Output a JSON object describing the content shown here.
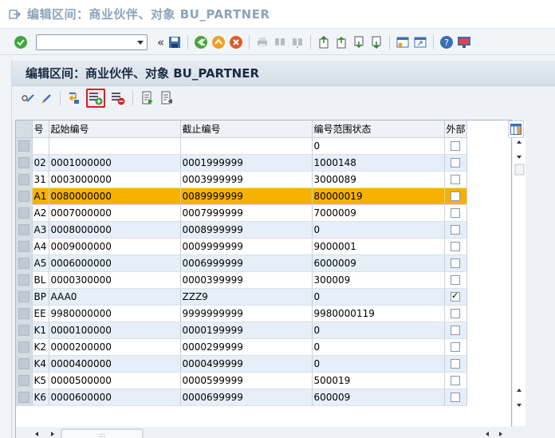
{
  "window": {
    "title": "编辑区间：商业伙伴、对象 BU_PARTNER"
  },
  "toolbar": {
    "command_field_value": "",
    "icons": [
      "enter-icon",
      "save-icon",
      "back-icon",
      "exit-icon",
      "cancel-icon",
      "print-icon",
      "find-icon",
      "find-next-icon",
      "first-page-icon",
      "previous-page-icon",
      "next-page-icon",
      "last-page-icon",
      "create-session-icon",
      "shortcut-icon",
      "help-icon",
      "customize-layout-icon"
    ]
  },
  "panel": {
    "title": "编辑区间：商业伙伴、对象 BU_PARTNER",
    "actions": [
      "display-change-icon",
      "edit-icon",
      "interval-status-icon",
      "insert-line-icon",
      "delete-line-icon",
      "export-icon",
      "import-icon"
    ]
  },
  "table": {
    "headers": {
      "no": "号",
      "from": "起始编号",
      "to": "截止编号",
      "status": "编号范围状态",
      "ext": "外部"
    },
    "rows": [
      {
        "no": "",
        "from": "",
        "to": "",
        "status": "0",
        "ext": false
      },
      {
        "no": "02",
        "from": "0001000000",
        "to": "0001999999",
        "status": "1000148",
        "ext": false
      },
      {
        "no": "31",
        "from": "0003000000",
        "to": "0003999999",
        "status": "3000089",
        "ext": false
      },
      {
        "no": "A1",
        "from": "0080000000",
        "to": "0089999999",
        "status": "80000019",
        "ext": false
      },
      {
        "no": "A2",
        "from": "0007000000",
        "to": "0007999999",
        "status": "7000009",
        "ext": false
      },
      {
        "no": "A3",
        "from": "0008000000",
        "to": "0008999999",
        "status": "0",
        "ext": false
      },
      {
        "no": "A4",
        "from": "0009000000",
        "to": "0009999999",
        "status": "9000001",
        "ext": false
      },
      {
        "no": "A5",
        "from": "0006000000",
        "to": "0006999999",
        "status": "6000009",
        "ext": false
      },
      {
        "no": "BL",
        "from": "0000300000",
        "to": "0000399999",
        "status": "300009",
        "ext": false
      },
      {
        "no": "BP",
        "from": "AAA0",
        "to": "ZZZ9",
        "status": "0",
        "ext": true
      },
      {
        "no": "EE",
        "from": "9980000000",
        "to": "9999999999",
        "status": "9980000119",
        "ext": false
      },
      {
        "no": "K1",
        "from": "0000100000",
        "to": "0000199999",
        "status": "0",
        "ext": false
      },
      {
        "no": "K2",
        "from": "0000200000",
        "to": "0000299999",
        "status": "0",
        "ext": false
      },
      {
        "no": "K4",
        "from": "0000400000",
        "to": "0000499999",
        "status": "0",
        "ext": false
      },
      {
        "no": "K5",
        "from": "0000500000",
        "to": "0000599999",
        "status": "500019",
        "ext": false
      },
      {
        "no": "K6",
        "from": "0000600000",
        "to": "0000699999",
        "status": "600009",
        "ext": false
      }
    ],
    "highlighted_row": 3
  },
  "scrollbar": {
    "grip": ":::"
  },
  "colors": {
    "highlight": "#f7b100",
    "alt_row": "#e6eff7",
    "title_text": "#1b2b44",
    "window_title_text": "#8ea3bb",
    "focus_outline": "#e8121d"
  }
}
